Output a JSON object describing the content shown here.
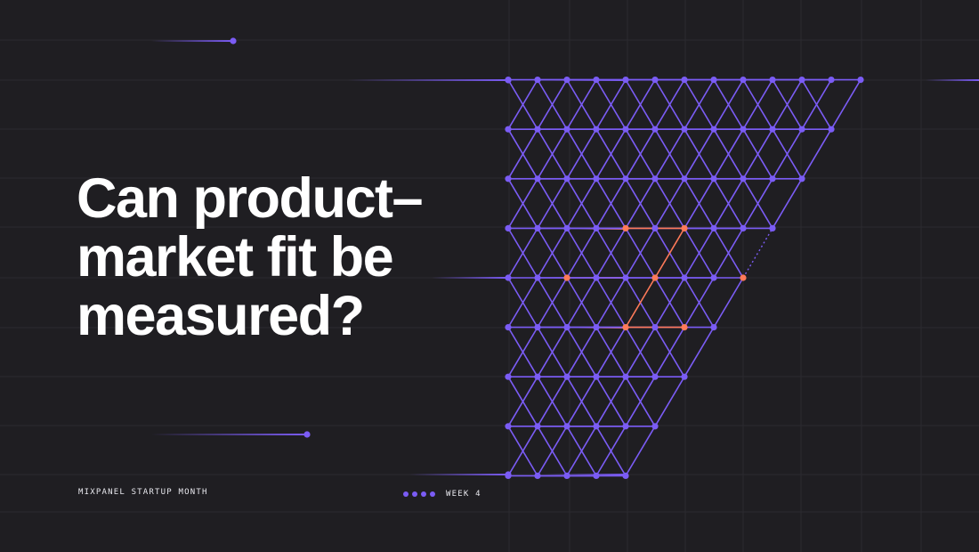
{
  "hero": {
    "lines": [
      "Can product–",
      "market fit be",
      "measured?"
    ]
  },
  "footer": {
    "brand": "MIXPANEL STARTUP MONTH",
    "week_label": "WEEK 4",
    "week_dot_count": 4
  },
  "colors": {
    "background": "#1f1e22",
    "grid_line": "#2c2b31",
    "accent_purple": "#7b5cf5",
    "accent_orange": "#ff7a59",
    "text": "#ffffff"
  },
  "illustration": {
    "description_icon": "isometric-cube-lattice-icon"
  }
}
